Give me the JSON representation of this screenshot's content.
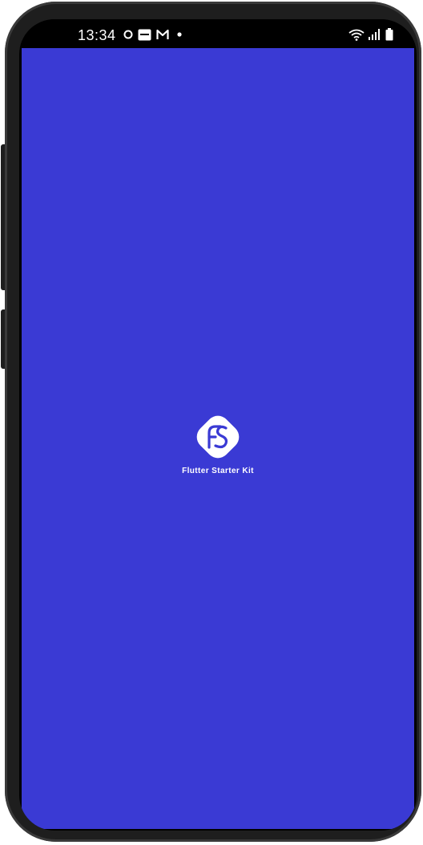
{
  "status_bar": {
    "time": "13:34",
    "left_icons": [
      "record-icon",
      "photo-icon",
      "gmail-icon",
      "notification-dot-icon"
    ],
    "right_icons": [
      "wifi-icon",
      "signal-icon",
      "battery-icon"
    ]
  },
  "splash": {
    "logo_icon": "fs-logo-icon",
    "title": "Flutter Starter Kit"
  },
  "colors": {
    "background": "#3a3ad4",
    "frame": "#1e1e1e",
    "status_bar": "#000000",
    "text": "#ffffff"
  }
}
